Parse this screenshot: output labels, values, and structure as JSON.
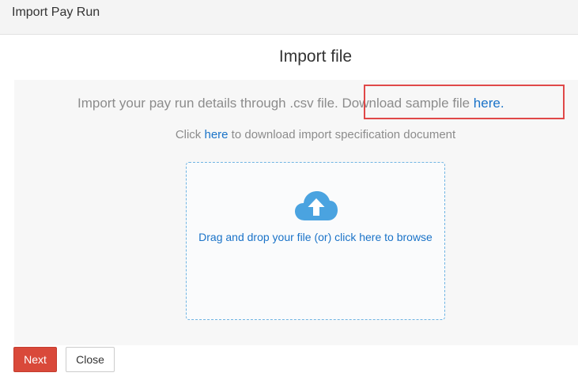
{
  "header": {
    "title": "Import Pay Run"
  },
  "main": {
    "title": "Import file",
    "import_text": "Import your pay run details through .csv file. Download sample file ",
    "sample_link": "here.",
    "spec_prefix": "Click ",
    "spec_link": "here",
    "spec_suffix": " to download import specification document",
    "dropzone_text": "Drag and drop your file (or) click here to browse"
  },
  "footer": {
    "next_label": "Next",
    "close_label": "Close"
  },
  "colors": {
    "accent": "#1a73c8",
    "primary_button": "#d9493a",
    "highlight": "#e04848",
    "upload_icon": "#4aa3e0"
  },
  "icons": {
    "upload": "cloud-upload-icon"
  }
}
